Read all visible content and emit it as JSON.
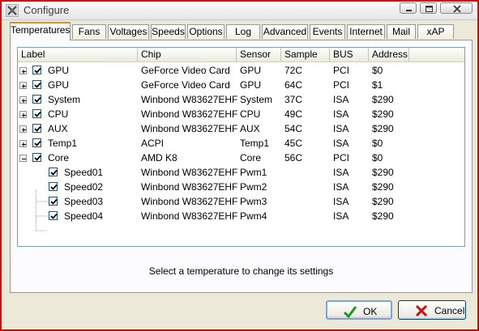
{
  "window": {
    "title": "Configure"
  },
  "tabs": [
    {
      "label": "Temperatures",
      "active": true
    },
    {
      "label": "Fans"
    },
    {
      "label": "Voltages"
    },
    {
      "label": "Speeds"
    },
    {
      "label": "Options"
    },
    {
      "label": "Log"
    },
    {
      "label": "Advanced"
    },
    {
      "label": "Events"
    },
    {
      "label": "Internet"
    },
    {
      "label": "Mail"
    },
    {
      "label": "xAP"
    }
  ],
  "columns": {
    "label": "Label",
    "chip": "Chip",
    "sensor": "Sensor",
    "sample": "Sample",
    "bus": "BUS",
    "address": "Address"
  },
  "rows": [
    {
      "label": "GPU",
      "chip": "GeForce Video Card",
      "sensor": "GPU",
      "sample": "72C",
      "bus": "PCI",
      "address": "$0",
      "checked": true,
      "expander": "plus",
      "child": false
    },
    {
      "label": "GPU",
      "chip": "GeForce Video Card",
      "sensor": "GPU",
      "sample": "64C",
      "bus": "PCI",
      "address": "$1",
      "checked": true,
      "expander": "plus",
      "child": false
    },
    {
      "label": "System",
      "chip": "Winbond W83627EHF",
      "sensor": "System",
      "sample": "37C",
      "bus": "ISA",
      "address": "$290",
      "checked": true,
      "expander": "plus",
      "child": false
    },
    {
      "label": "CPU",
      "chip": "Winbond W83627EHF",
      "sensor": "CPU",
      "sample": "49C",
      "bus": "ISA",
      "address": "$290",
      "checked": true,
      "expander": "plus",
      "child": false
    },
    {
      "label": "AUX",
      "chip": "Winbond W83627EHF",
      "sensor": "AUX",
      "sample": "54C",
      "bus": "ISA",
      "address": "$290",
      "checked": true,
      "expander": "plus",
      "child": false
    },
    {
      "label": "Temp1",
      "chip": "ACPI",
      "sensor": "Temp1",
      "sample": "45C",
      "bus": "ISA",
      "address": "$0",
      "checked": true,
      "expander": "plus",
      "child": false
    },
    {
      "label": "Core",
      "chip": "AMD K8",
      "sensor": "Core",
      "sample": "56C",
      "bus": "PCI",
      "address": "$0",
      "checked": true,
      "expander": "minus",
      "child": false
    },
    {
      "label": "Speed01",
      "chip": "Winbond W83627EHF",
      "sensor": "Pwm1",
      "sample": "",
      "bus": "ISA",
      "address": "$290",
      "checked": true,
      "expander": "",
      "child": true
    },
    {
      "label": "Speed02",
      "chip": "Winbond W83627EHF",
      "sensor": "Pwm2",
      "sample": "",
      "bus": "ISA",
      "address": "$290",
      "checked": true,
      "expander": "",
      "child": true
    },
    {
      "label": "Speed03",
      "chip": "Winbond W83627EHF",
      "sensor": "Pwm3",
      "sample": "",
      "bus": "ISA",
      "address": "$290",
      "checked": true,
      "expander": "",
      "child": true
    },
    {
      "label": "Speed04",
      "chip": "Winbond W83627EHF",
      "sensor": "Pwm4",
      "sample": "",
      "bus": "ISA",
      "address": "$290",
      "checked": true,
      "expander": "",
      "child": true
    }
  ],
  "status_text": "Select a temperature to change its settings",
  "buttons": {
    "ok": "OK",
    "cancel": "Cancel"
  },
  "colors": {
    "accent": "#e68b2c",
    "ok_icon": "#1a9a1a",
    "cancel_icon": "#cc1010",
    "highlight_border": "#e00000"
  },
  "icons": {
    "app": "settings-icon",
    "ok": "checkmark-icon",
    "cancel": "x-icon"
  }
}
